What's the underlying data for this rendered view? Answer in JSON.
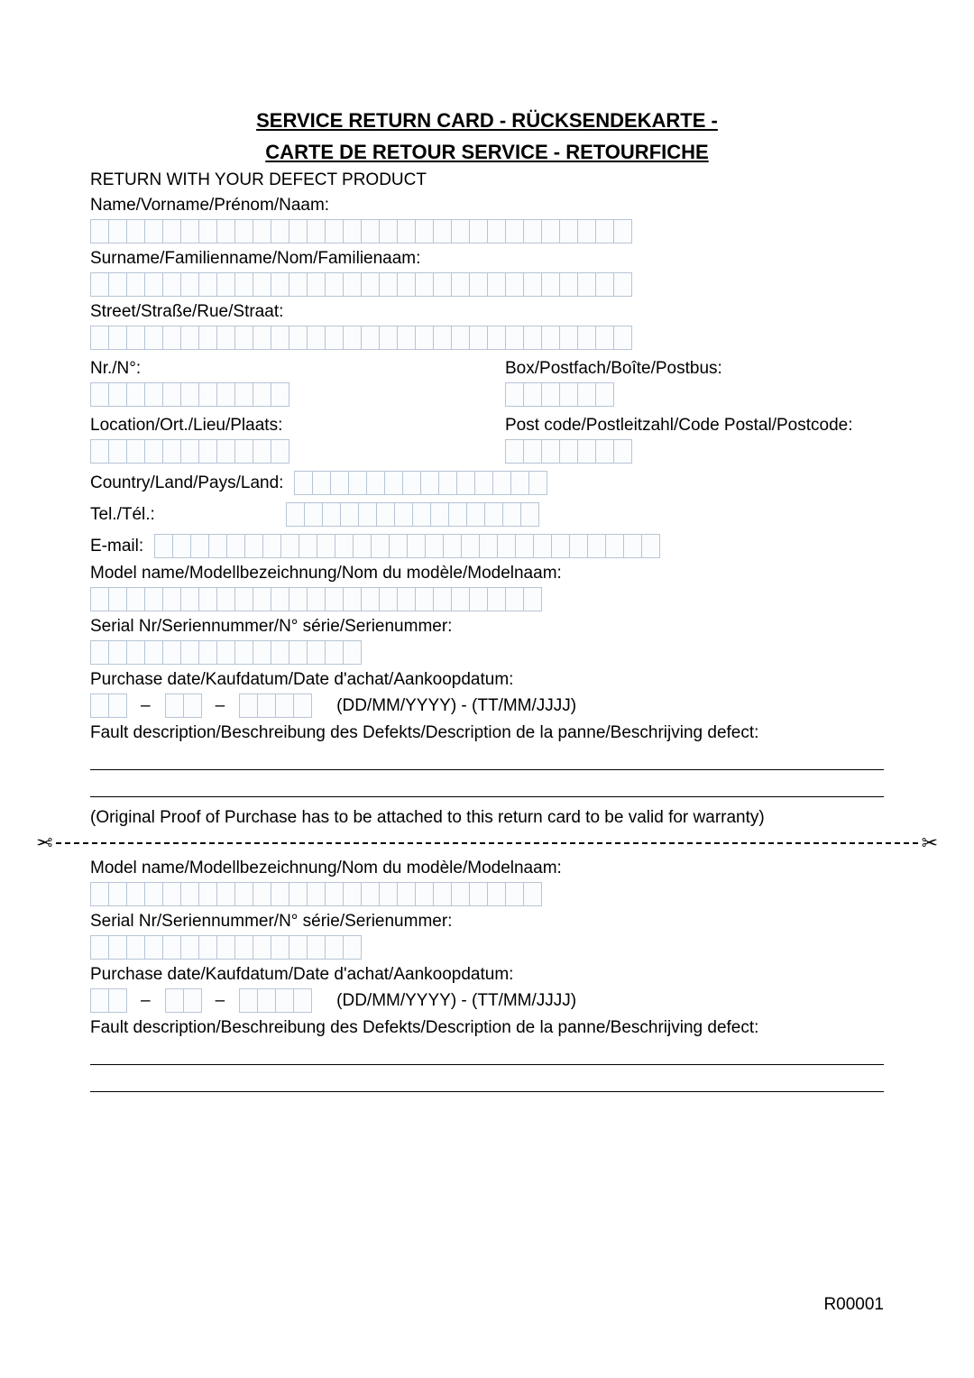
{
  "title_line1": "SERVICE RETURN CARD - RÜCKSENDEKARTE -",
  "title_line2": "CARTE DE RETOUR SERVICE - RETOURFICHE",
  "instruction": "RETURN WITH YOUR DEFECT PRODUCT",
  "labels": {
    "name": "Name/Vorname/Prénom/Naam:",
    "surname": "Surname/Familienname/Nom/Familienaam:",
    "street": "Street/Straße/Rue/Straat:",
    "nr": "Nr./N°:",
    "box": "Box/Postfach/Boîte/Postbus:",
    "location": "Location/Ort./Lieu/Plaats:",
    "postcode": "Post code/Postleitzahl/Code Postal/Postcode:",
    "country": "Country/Land/Pays/Land:",
    "tel": "Tel./Tél.:",
    "email": "E-mail:",
    "model": "Model name/Modellbezeichnung/Nom du modèle/Modelnaam:",
    "serial": "Serial Nr/Seriennummer/N° série/Serienummer:",
    "purchase": "Purchase date/Kaufdatum/Date d'achat/Aankoopdatum:",
    "dateformat": "(DD/MM/YYYY) - (TT/MM/JJJJ)",
    "fault": "Fault description/Beschreibung des Defekts/Description de la panne/Beschrijving defect:"
  },
  "proof_note": "(Original Proof of Purchase has to be attached to this return card to be valid for warranty)",
  "footer": "R00001",
  "box_counts": {
    "name": 30,
    "surname": 30,
    "street": 30,
    "nr": 11,
    "box": 6,
    "location": 11,
    "postcode": 7,
    "country": 14,
    "tel": 14,
    "email": 28,
    "model": 25,
    "serial": 15,
    "date_dd": 2,
    "date_mm": 2,
    "date_yyyy": 4
  }
}
